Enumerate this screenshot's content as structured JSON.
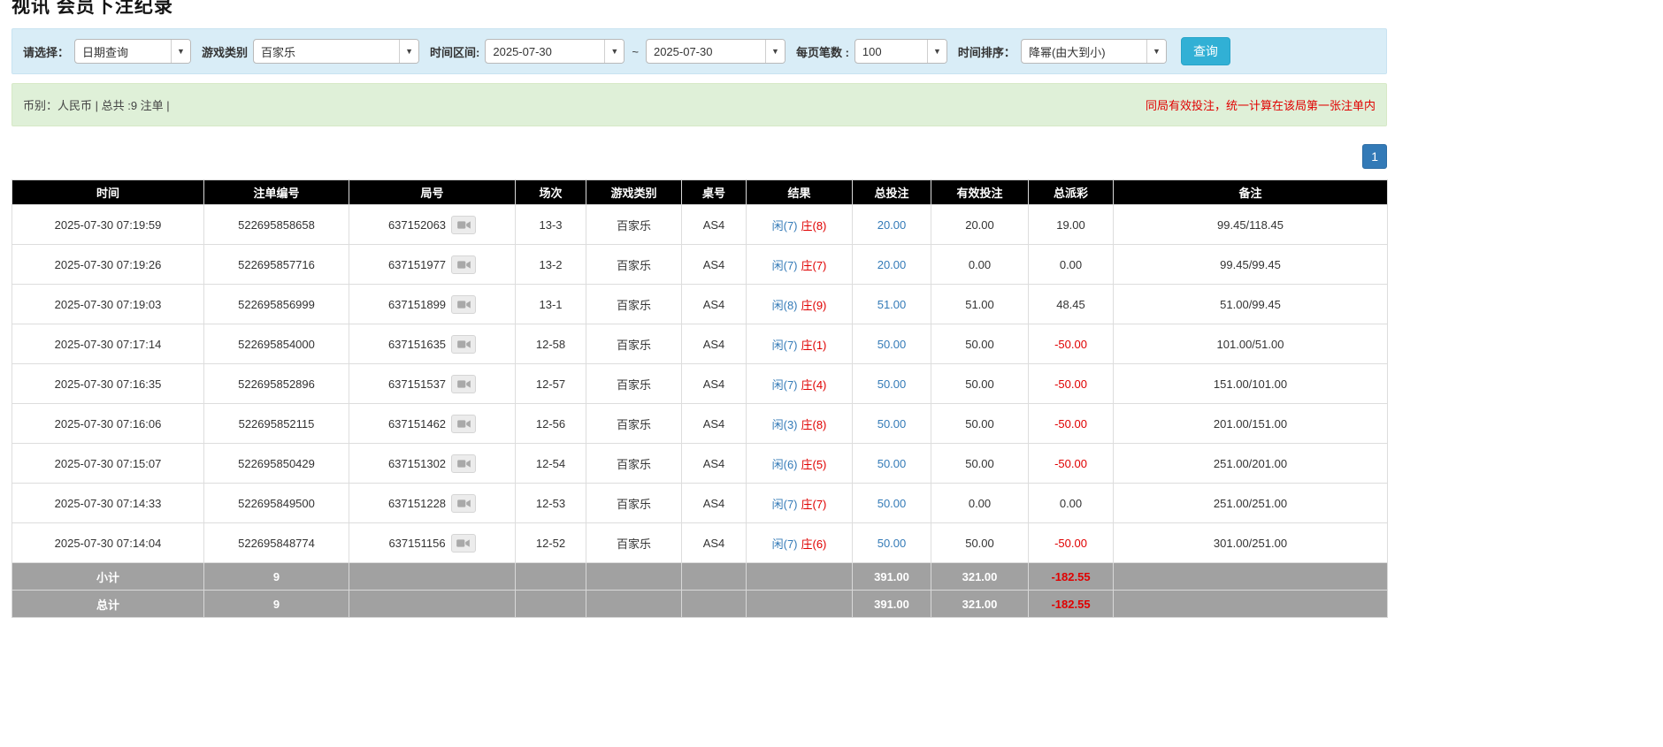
{
  "page": {
    "title": "视讯 会员下注纪录"
  },
  "colors": {
    "header_bg": "#000000",
    "filter_bar_bg": "#d9edf7",
    "summary_bar_bg": "#dff0d8",
    "highlight_row_bg": "#ffffb8",
    "footer_row_bg": "#a1a1a1",
    "link_blue": "#337ab7",
    "negative_red": "#e00000",
    "notice_red": "#e00000",
    "search_button_bg": "#31b0d5",
    "pagination_bg": "#337ab7"
  },
  "filters": {
    "select_label": "请选择：",
    "select_value": "日期查询",
    "game_type_label": "游戏类别",
    "game_type_value": "百家乐",
    "time_range_label": "时间区间:",
    "date_from": "2025-07-30",
    "date_separator": "~",
    "date_to": "2025-07-30",
    "page_size_label": "每页笔数 :",
    "page_size_value": "100",
    "sort_label": "时间排序：",
    "sort_value": "降幂(由大到小)",
    "search_button": "查询"
  },
  "summary": {
    "left": "币别：人民币 | 总共 :9 注单 |",
    "right_notice": "同局有效投注，统一计算在该局第一张注单内"
  },
  "pagination": {
    "current": "1"
  },
  "table": {
    "headers": [
      "时间",
      "注单编号",
      "局号",
      "场次",
      "游戏类别",
      "桌号",
      "结果",
      "总投注",
      "有效投注",
      "总派彩",
      "备注"
    ],
    "rows": [
      {
        "time": "2025-07-30 07:19:59",
        "bet_id": "522695858658",
        "round_id": "637152063",
        "session": "13-3",
        "game": "百家乐",
        "table_no": "AS4",
        "result_player": "闲(7)",
        "result_banker": "庄(8)",
        "total_bet": "20.00",
        "valid_bet": "20.00",
        "payout": "19.00",
        "note": "99.45/118.45",
        "highlight": false
      },
      {
        "time": "2025-07-30 07:19:26",
        "bet_id": "522695857716",
        "round_id": "637151977",
        "session": "13-2",
        "game": "百家乐",
        "table_no": "AS4",
        "result_player": "闲(7)",
        "result_banker": "庄(7)",
        "total_bet": "20.00",
        "valid_bet": "0.00",
        "payout": "0.00",
        "note": "99.45/99.45",
        "highlight": false
      },
      {
        "time": "2025-07-30 07:19:03",
        "bet_id": "522695856999",
        "round_id": "637151899",
        "session": "13-1",
        "game": "百家乐",
        "table_no": "AS4",
        "result_player": "闲(8)",
        "result_banker": "庄(9)",
        "total_bet": "51.00",
        "valid_bet": "51.00",
        "payout": "48.45",
        "note": "51.00/99.45",
        "highlight": false
      },
      {
        "time": "2025-07-30 07:17:14",
        "bet_id": "522695854000",
        "round_id": "637151635",
        "session": "12-58",
        "game": "百家乐",
        "table_no": "AS4",
        "result_player": "闲(7)",
        "result_banker": "庄(1)",
        "total_bet": "50.00",
        "valid_bet": "50.00",
        "payout": "-50.00",
        "note": "101.00/51.00",
        "highlight": false
      },
      {
        "time": "2025-07-30 07:16:35",
        "bet_id": "522695852896",
        "round_id": "637151537",
        "session": "12-57",
        "game": "百家乐",
        "table_no": "AS4",
        "result_player": "闲(7)",
        "result_banker": "庄(4)",
        "total_bet": "50.00",
        "valid_bet": "50.00",
        "payout": "-50.00",
        "note": "151.00/101.00",
        "highlight": true
      },
      {
        "time": "2025-07-30 07:16:06",
        "bet_id": "522695852115",
        "round_id": "637151462",
        "session": "12-56",
        "game": "百家乐",
        "table_no": "AS4",
        "result_player": "闲(3)",
        "result_banker": "庄(8)",
        "total_bet": "50.00",
        "valid_bet": "50.00",
        "payout": "-50.00",
        "note": "201.00/151.00",
        "highlight": false
      },
      {
        "time": "2025-07-30 07:15:07",
        "bet_id": "522695850429",
        "round_id": "637151302",
        "session": "12-54",
        "game": "百家乐",
        "table_no": "AS4",
        "result_player": "闲(6)",
        "result_banker": "庄(5)",
        "total_bet": "50.00",
        "valid_bet": "50.00",
        "payout": "-50.00",
        "note": "251.00/201.00",
        "highlight": false
      },
      {
        "time": "2025-07-30 07:14:33",
        "bet_id": "522695849500",
        "round_id": "637151228",
        "session": "12-53",
        "game": "百家乐",
        "table_no": "AS4",
        "result_player": "闲(7)",
        "result_banker": "庄(7)",
        "total_bet": "50.00",
        "valid_bet": "0.00",
        "payout": "0.00",
        "note": "251.00/251.00",
        "highlight": false
      },
      {
        "time": "2025-07-30 07:14:04",
        "bet_id": "522695848774",
        "round_id": "637151156",
        "session": "12-52",
        "game": "百家乐",
        "table_no": "AS4",
        "result_player": "闲(7)",
        "result_banker": "庄(6)",
        "total_bet": "50.00",
        "valid_bet": "50.00",
        "payout": "-50.00",
        "note": "301.00/251.00",
        "highlight": false
      }
    ],
    "subtotal": {
      "label": "小计",
      "count": "9",
      "total_bet": "391.00",
      "valid_bet": "321.00",
      "payout": "-182.55"
    },
    "total": {
      "label": "总计",
      "count": "9",
      "total_bet": "391.00",
      "valid_bet": "321.00",
      "payout": "-182.55"
    }
  }
}
